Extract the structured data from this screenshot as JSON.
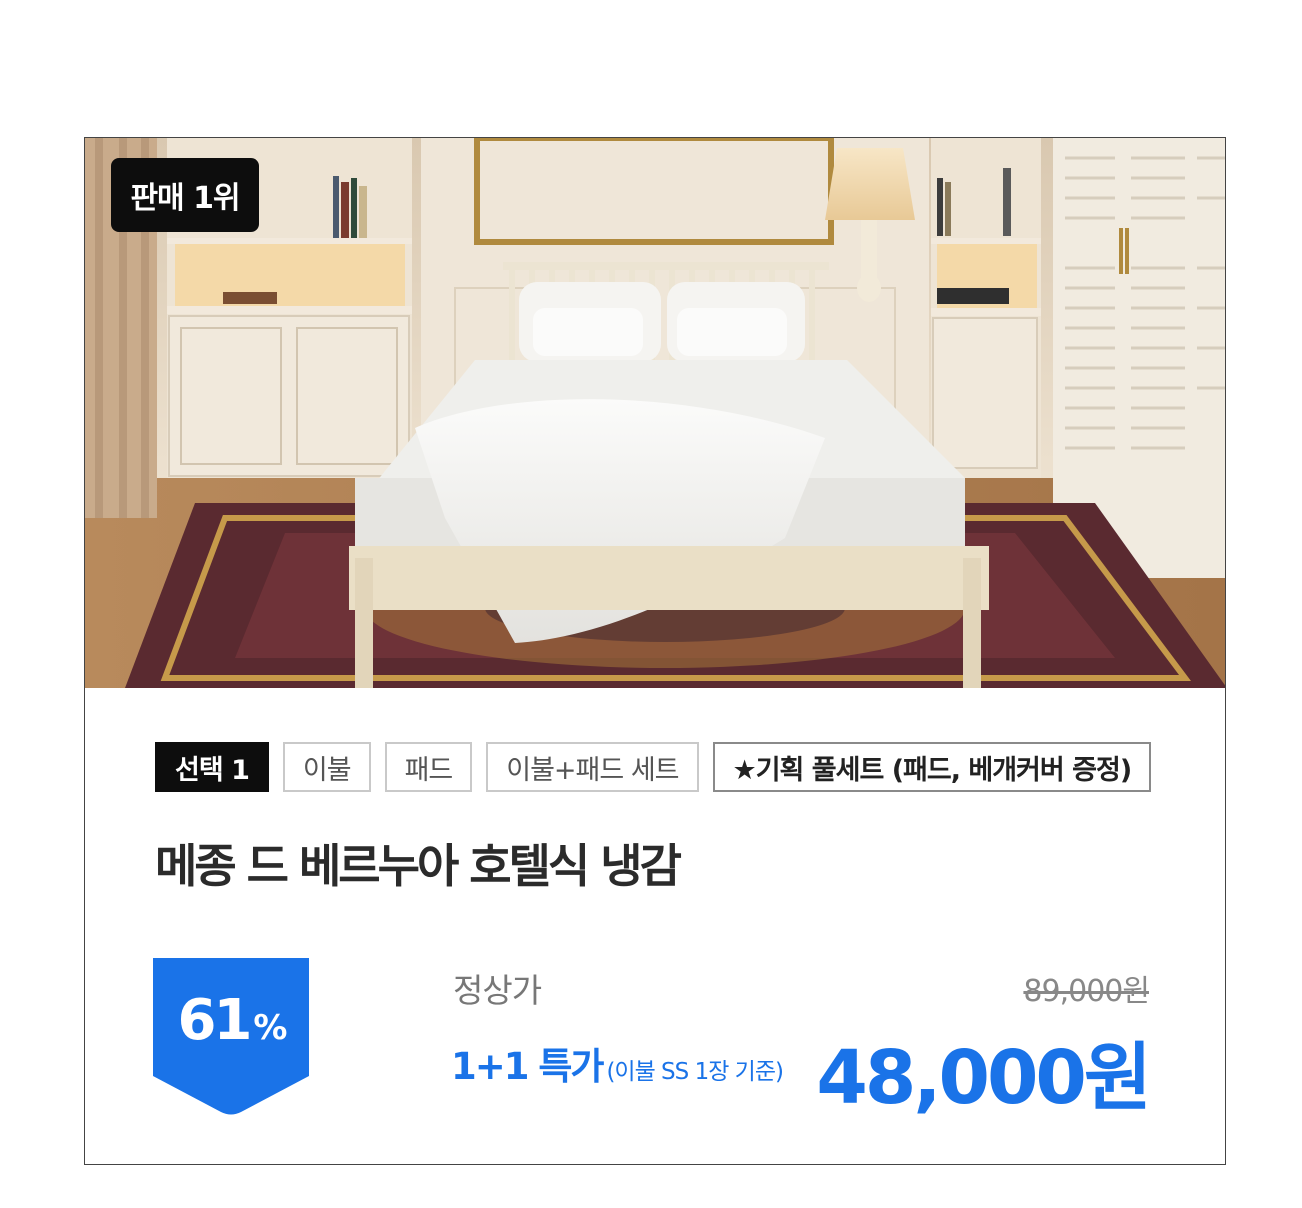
{
  "product": {
    "rank_badge": "판매 1위",
    "option_label": "선택 1",
    "options": [
      "이불",
      "패드",
      "이불+패드 세트",
      "★기획 풀세트 (패드, 베개커버 증정)"
    ],
    "title": "메종 드 베르누아 호텔식 냉감",
    "discount_value": "61",
    "discount_symbol": "%",
    "regular_price_label": "정상가",
    "regular_price": "89,000원",
    "promo_text": "1+1 특가",
    "promo_note": "(이불 SS 1장 기준)",
    "sale_price": "48,000원"
  },
  "colors": {
    "accent": "#1a73e8",
    "badge_bg": "#0d0d0d",
    "border": "#444444"
  }
}
